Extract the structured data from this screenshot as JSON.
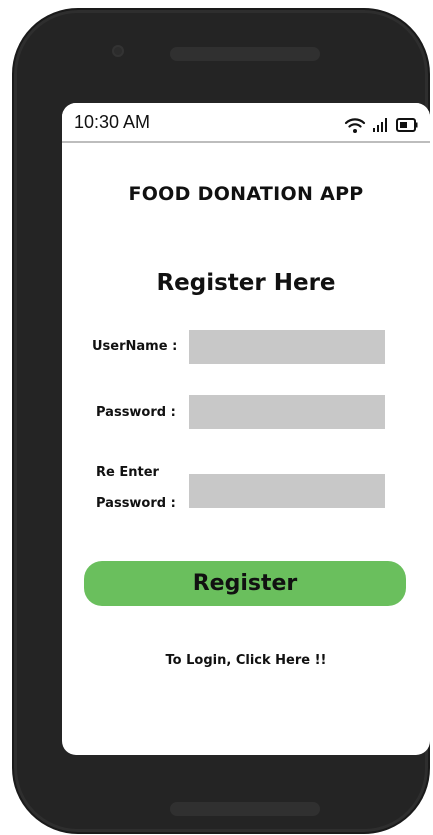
{
  "status_bar": {
    "time": "10:30 AM"
  },
  "app": {
    "title": "FOOD DONATION APP"
  },
  "form": {
    "heading": "Register Here",
    "username_label": "UserName :",
    "username_value": "",
    "password_label": "Password :",
    "password_value": "",
    "reenter_label_line1": "Re Enter",
    "reenter_label_line2": "Password :",
    "reenter_value": "",
    "register_button": "Register",
    "login_link": "To Login, Click Here !!"
  },
  "colors": {
    "button": "#6abf5d",
    "input_bg": "#c8c8c8",
    "phone_body": "#242424"
  },
  "icons": [
    "wifi-icon",
    "signal-icon",
    "battery-icon"
  ]
}
